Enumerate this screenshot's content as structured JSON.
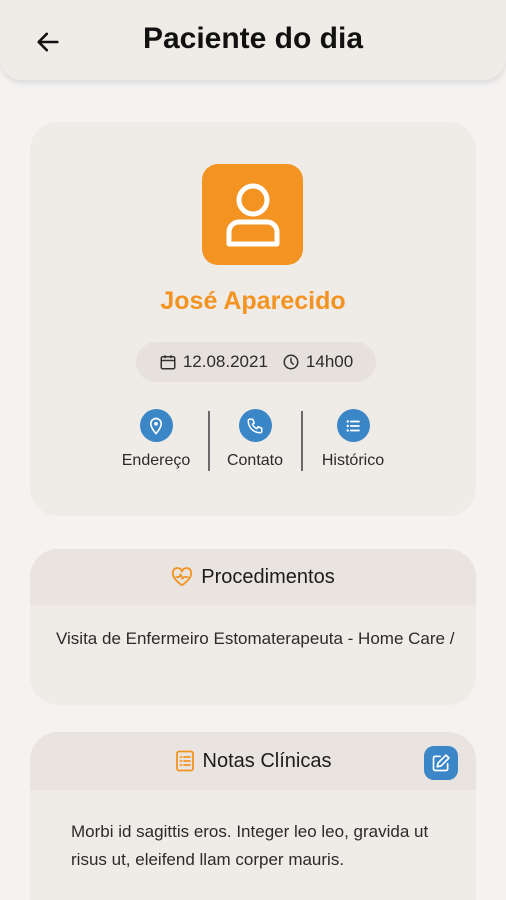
{
  "header": {
    "title": "Paciente do dia",
    "back_icon": "arrow-left-icon"
  },
  "patient": {
    "name": "José Aparecido",
    "avatar_icon": "user-icon",
    "date": "12.08.2021",
    "time": "14h00",
    "actions": [
      {
        "label": "Endereço",
        "icon": "location-pin-icon"
      },
      {
        "label": "Contato",
        "icon": "phone-icon"
      },
      {
        "label": "Histórico",
        "icon": "list-icon"
      }
    ]
  },
  "procedures": {
    "title": "Procedimentos",
    "icon": "heart-pulse-icon",
    "text": "Visita de Enfermeiro Estomaterapeuta - Home Care /"
  },
  "notes": {
    "title": "Notas Clínicas",
    "icon": "notes-icon",
    "edit_icon": "edit-icon",
    "text": "Morbi id sagittis eros. Integer leo leo, gravida ut risus ut, eleifend  llam corper mauris."
  },
  "colors": {
    "accent": "#f39322",
    "primary": "#3b86c7",
    "background": "#f4f3f2",
    "card": "#efebe7"
  }
}
